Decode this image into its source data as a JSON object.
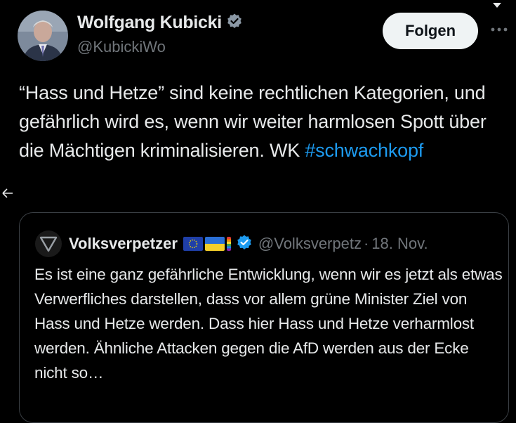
{
  "author": {
    "name": "Wolfgang Kubicki",
    "handle": "@KubickiWo",
    "avatar_icon": "person-photo-avatar",
    "verified_icon": "verified-badge-icon"
  },
  "actions": {
    "follow_label": "Folgen",
    "more_icon": "more-dots-icon"
  },
  "tweet": {
    "text": "“Hass und Hetze” sind keine rechtlichen Kategorien, und gefährlich wird es, wenn wir weiter harmlosen Spott über die Mächtigen kriminalisieren. WK ",
    "hashtag": "#schwachkopf"
  },
  "quote": {
    "author_name": "Volksverpetzer",
    "handle": "@Volksverpetz",
    "separator": "·",
    "date": "18. Nov.",
    "text": "Es ist eine ganz gefährliche Entwicklung, wenn wir es jetzt als etwas Verwerfliches darstellen, dass vor allem grüne Minister Ziel von Hass und Hetze werden. Dass hier Hass und Hetze verharmlost werden. Ähnliche Attacken gegen die AfD werden aus der Ecke nicht so…",
    "flags": [
      "eu-flag-icon",
      "ukraine-flag-icon",
      "rainbow-flag-icon"
    ]
  },
  "colors": {
    "background": "#000000",
    "text": "#e7e9ea",
    "secondary_text": "#71767b",
    "link": "#1d9bf0",
    "follow_button_bg": "#eff3f4",
    "border": "#3a3f44"
  }
}
